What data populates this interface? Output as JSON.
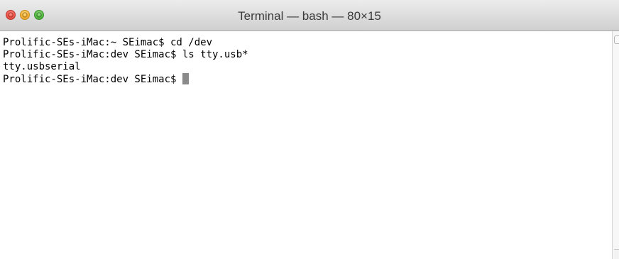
{
  "window": {
    "title": "Terminal — bash — 80×15"
  },
  "buttons": {
    "close_icon": "close-icon",
    "minimize_icon": "minimize-icon",
    "zoom_icon": "zoom-icon"
  },
  "terminal": {
    "lines": [
      "Prolific-SEs-iMac:~ SEimac$ cd /dev",
      "Prolific-SEs-iMac:dev SEimac$ ls tty.usb*",
      "tty.usbserial"
    ],
    "prompt": "Prolific-SEs-iMac:dev SEimac$ ",
    "cursor_color": "#8a8a8a"
  },
  "colors": {
    "close": "#f25a4f",
    "minimize": "#f7b43a",
    "zoom": "#5cbf45",
    "background": "#ffffff",
    "text": "#000000"
  }
}
